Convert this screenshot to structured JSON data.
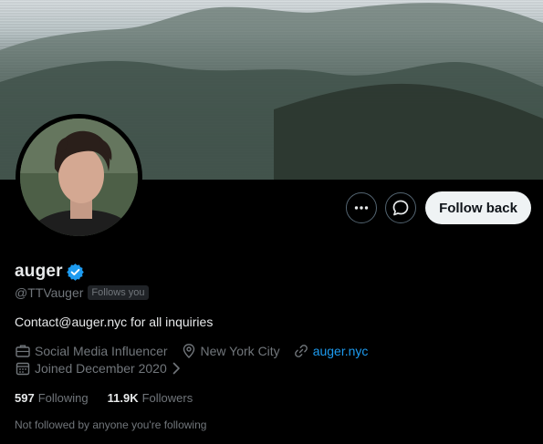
{
  "profile": {
    "display_name": "auger",
    "handle": "@TTVauger",
    "follows_you_badge": "Follows you",
    "bio": "Contact@auger.nyc for all inquiries",
    "category": "Social Media Influencer",
    "location": "New York City",
    "website": "auger.nyc",
    "joined": "Joined December 2020",
    "verified": true
  },
  "actions": {
    "follow_back_label": "Follow back",
    "more_icon": "more-icon",
    "message_icon": "message-icon"
  },
  "stats": {
    "following_count": "597",
    "following_label": "Following",
    "followers_count": "11.9K",
    "followers_label": "Followers"
  },
  "social_context": "Not followed by anyone you're following",
  "colors": {
    "background": "#000000",
    "text_primary": "#e7e9ea",
    "text_secondary": "#71767b",
    "link": "#1d9bf0",
    "verified": "#1d9bf0",
    "follow_button_bg": "#eff3f4"
  }
}
